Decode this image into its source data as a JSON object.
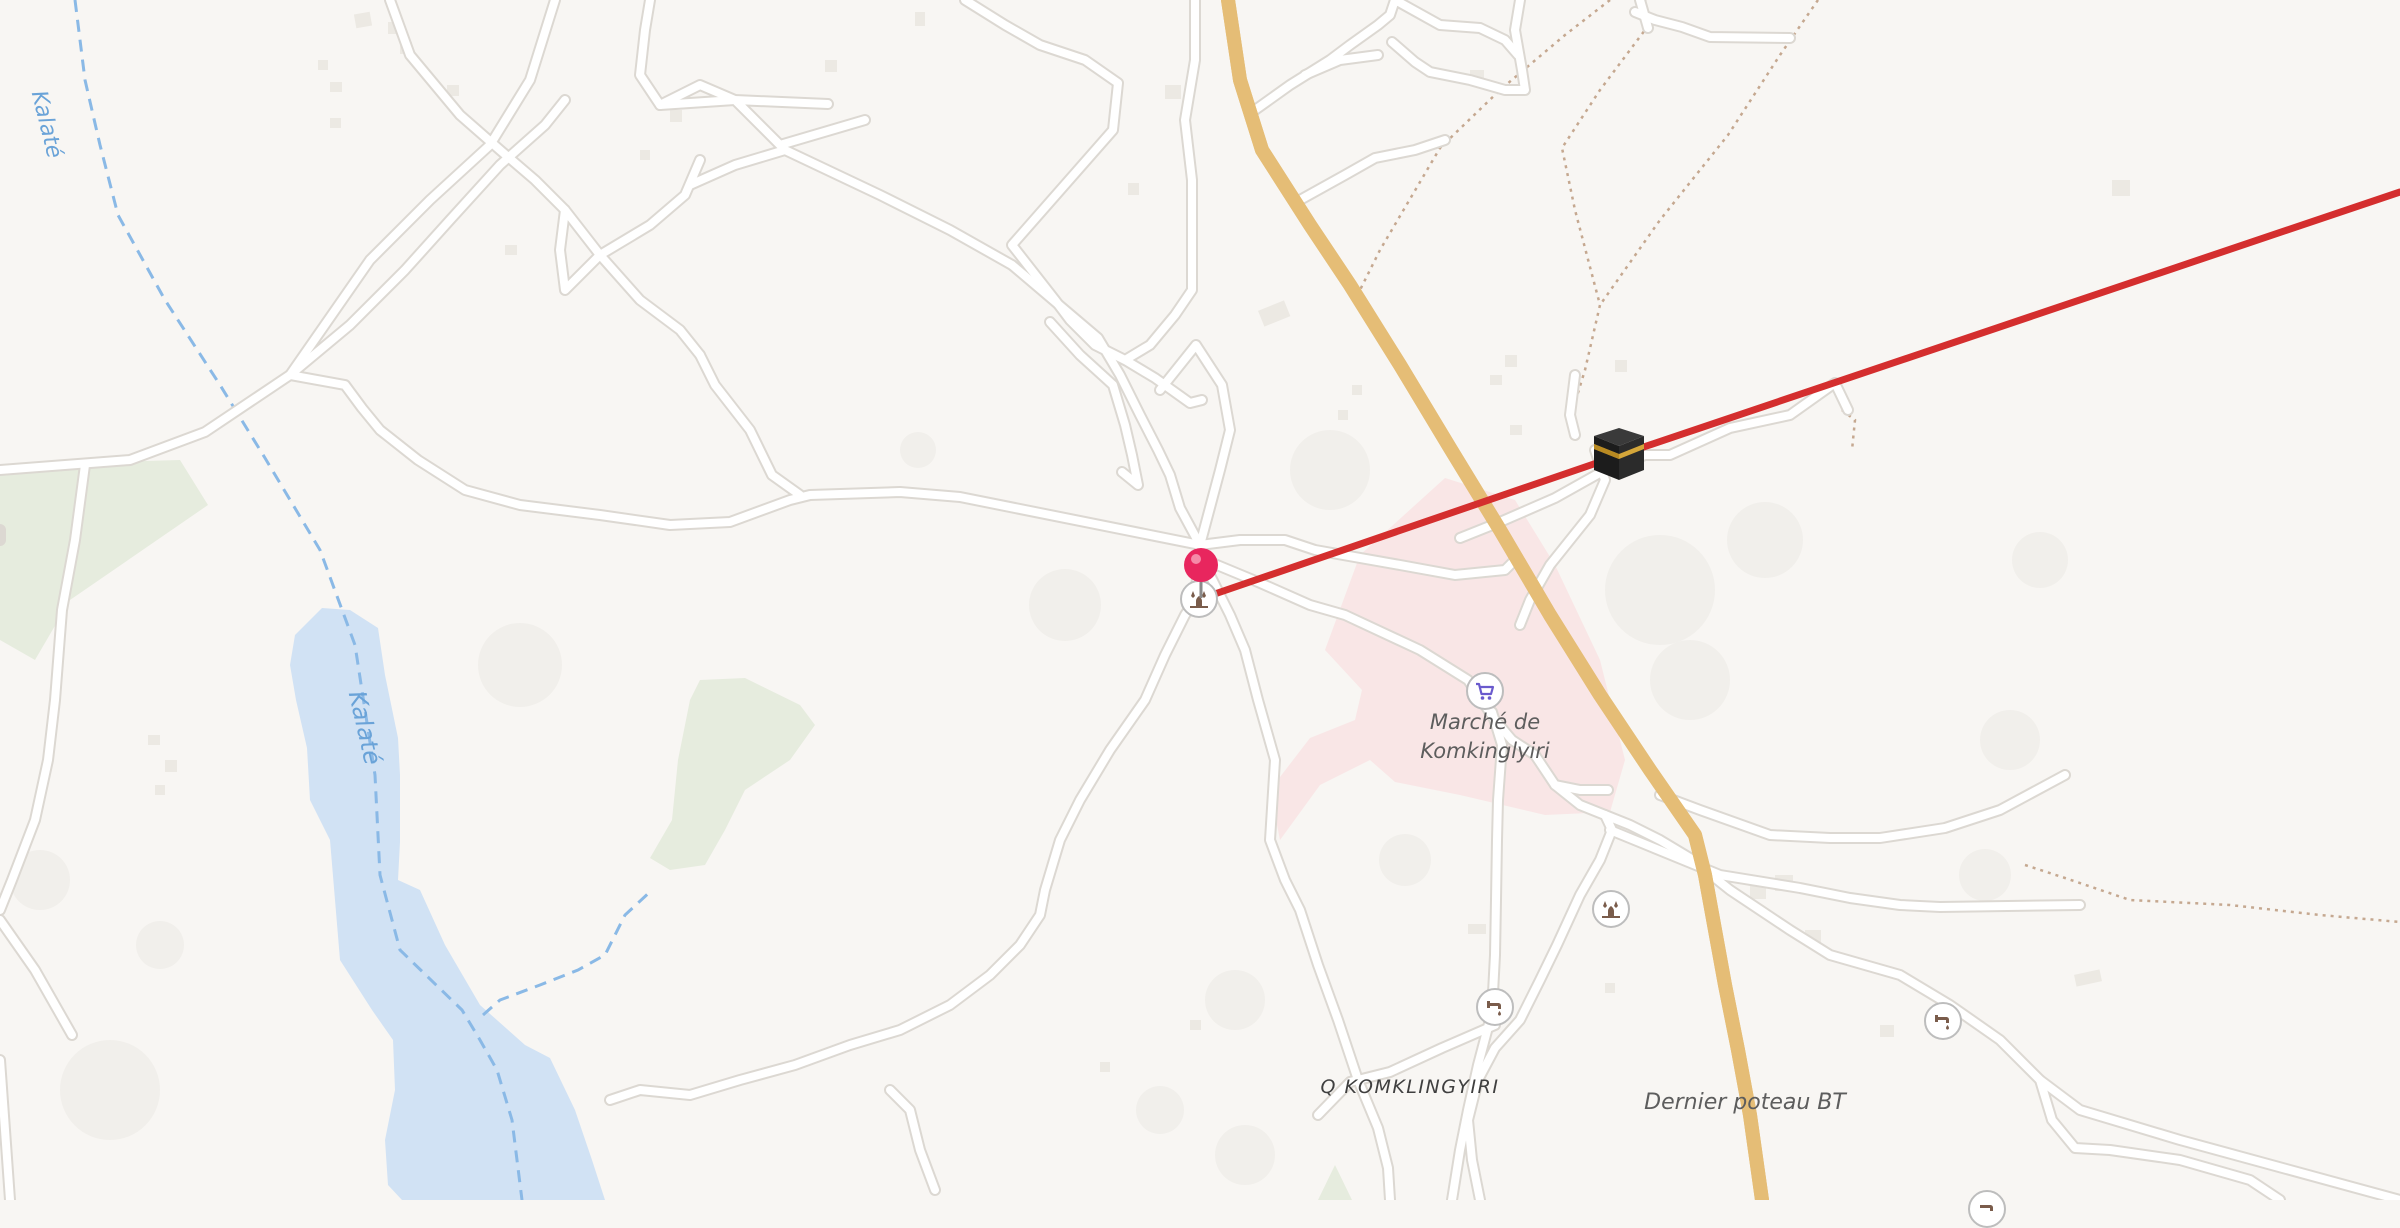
{
  "map": {
    "labels": {
      "market": "Marché de\nKomkinglyiri",
      "quarter": "Q KOMKLINGYIRI",
      "pole": "Dernier poteau BT"
    },
    "rivers": [
      "Kalaté",
      "Kalaté"
    ],
    "route": {
      "color": "#d42e2e",
      "from": "marker-pin",
      "to": "qibla-direction"
    },
    "colors": {
      "background": "#f8f6f3",
      "road": "#ffffff",
      "road_casing": "#dcd8d2",
      "main_road": "#fcdd95",
      "main_road_casing": "#e5bd76",
      "water": "#d1e2f4",
      "river_line": "#8ab9e6",
      "park": "#e6ecde",
      "marketplace": "#f9e6e6",
      "path": "#c5a890",
      "route": "#d42e2e",
      "pin": "#e8265e"
    },
    "icons": [
      "mosque-icon",
      "market-cart-icon",
      "water-tap-icon",
      "kaaba-icon",
      "map-pin-icon"
    ]
  }
}
